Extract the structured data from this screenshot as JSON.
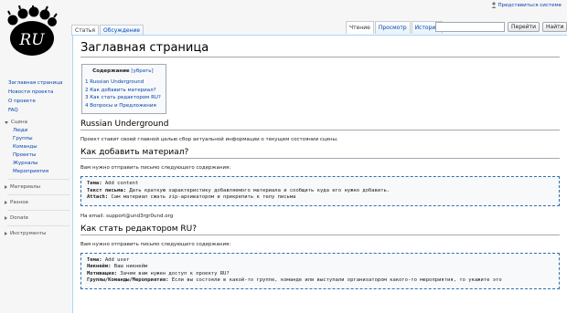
{
  "logo": {
    "text": "RU"
  },
  "personal": {
    "login": "Представиться системе"
  },
  "tabs": {
    "article": "Статья",
    "discussion": "Обсуждение",
    "read": "Чтение",
    "view_source": "Просмотр",
    "history": "История"
  },
  "search": {
    "placeholder": "",
    "go": "Перейти",
    "find": "Найти"
  },
  "sidebar": {
    "main": [
      "Заглавная страница",
      "Новости проекта",
      "О проекте",
      "FAQ"
    ],
    "scene_label": "Сцена",
    "scene_items": [
      "Люди",
      "Группы",
      "Команды",
      "Проекты",
      "Журналы",
      "Мероприятия"
    ],
    "collapsed": [
      "Материалы",
      "Разное",
      "Donate",
      "Инструменты"
    ]
  },
  "page": {
    "title": "Заглавная страница",
    "toc": {
      "title": "Содержание",
      "hide": "[убрать]",
      "items": [
        "1 Russian Underground",
        "2 Как добавить материал?",
        "3 Как стать редактором RU?",
        "4 Вопросы и Предложения"
      ]
    },
    "s1": {
      "heading": "Russian Underground",
      "text": "Проект ставит своей главной целью сбор актуальной информации о текущем состоянии сцены."
    },
    "s2": {
      "heading": "Как добавить материал?",
      "intro": "Вам нужно отправить письмо следующего содержания:",
      "l1k": "Тема:",
      "l1v": " Add content",
      "l2k": "Текст письма:",
      "l2v": " Дать краткую характеристику добавляемого материала и сообщить куда его нужно добавить.",
      "l3k": "Attach:",
      "l3v": " Сам материал сжать zip-архиватором и прикрепить к телу письма",
      "email": "На email: support@und3rgr0und.org"
    },
    "s3": {
      "heading": "Как стать редактором RU?",
      "intro": "Вам нужно отправить письмо следующего содержания:",
      "l1k": "Тема:",
      "l1v": " Add user",
      "l2k": "Никнейм:",
      "l2v": " Ваш никнейм",
      "l3k": "Мотивация:",
      "l3v": " Зачем вам нужен доступ к проекту RU?",
      "l4k": "Группы/Команды/Мероприятия:",
      "l4v": " Если вы состояли в какой-то группе, команде или выступали организатором какого-то мероприятия, то укажите это"
    }
  },
  "colors": {
    "link": "#0645ad",
    "border": "#a7d7f9"
  }
}
